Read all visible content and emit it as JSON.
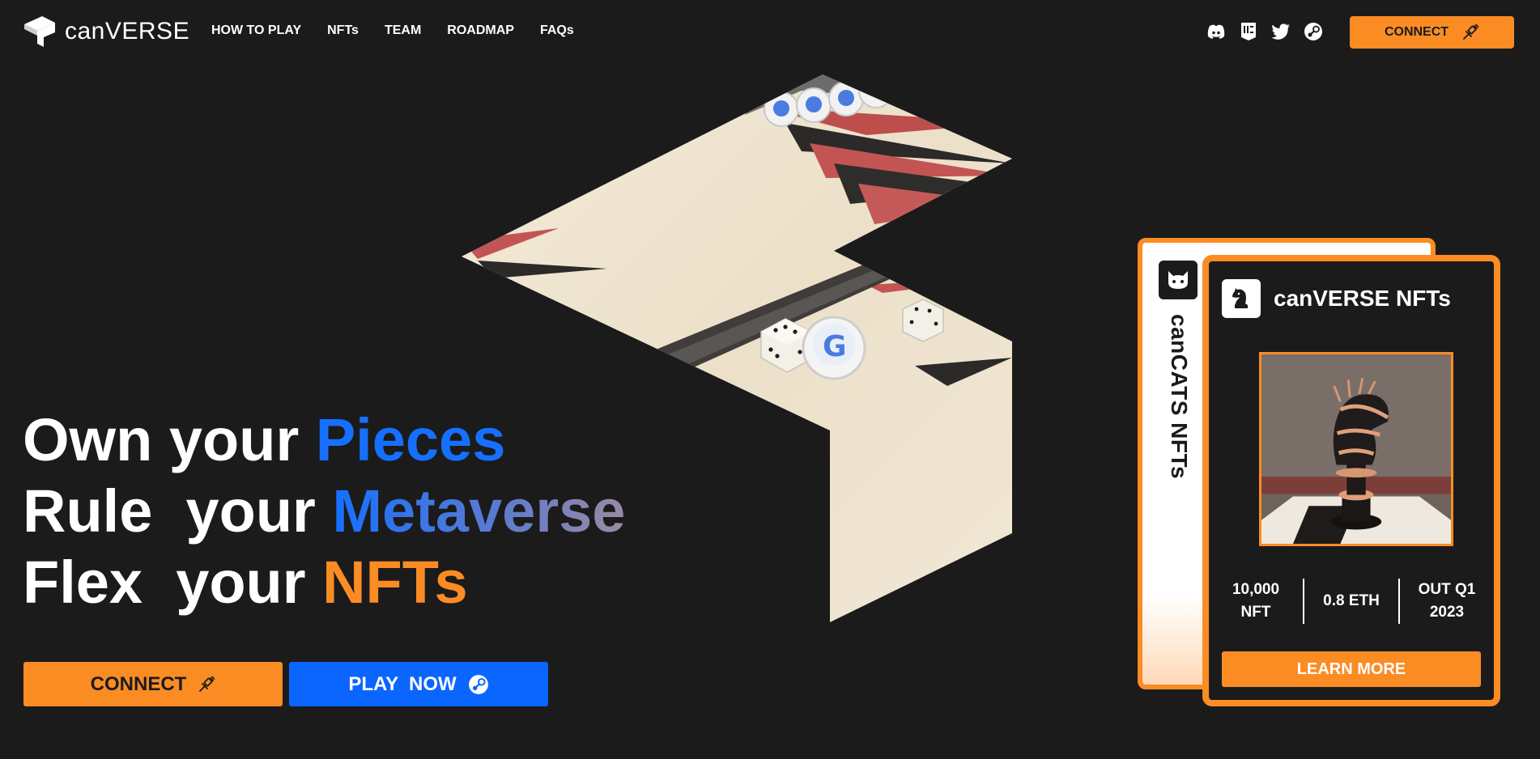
{
  "brand": {
    "name_prefix": "can",
    "name_suffix": "VERSE"
  },
  "nav": {
    "items": [
      "HOW TO PLAY",
      "NFTs",
      "TEAM",
      "ROADMAP",
      "FAQs"
    ]
  },
  "socials": [
    "discord-icon",
    "epic-games-icon",
    "twitter-icon",
    "steam-icon"
  ],
  "header": {
    "connect_label": "CONNECT"
  },
  "hero": {
    "line1": {
      "prefix": "Own your ",
      "highlight": "Pieces"
    },
    "line2": {
      "prefix": "Rule  your ",
      "highlight": "Metaverse"
    },
    "line3": {
      "prefix": "Flex  your ",
      "highlight": "NFTs"
    },
    "connect_label": "CONNECT",
    "play_label": "PLAY  NOW"
  },
  "cards": {
    "back": {
      "label": "canCATS NFTs"
    },
    "front": {
      "title": "canVERSE NFTs",
      "stats": [
        {
          "line1": "10,000",
          "line2": "NFT"
        },
        {
          "line1": "0.8 ETH",
          "line2": ""
        },
        {
          "line1": "OUT Q1",
          "line2": "2023"
        }
      ],
      "learn_more_label": "LEARN MORE"
    }
  },
  "colors": {
    "background": "#1b1b1c",
    "accent_orange": "#fb8c24",
    "accent_blue": "#1670ff",
    "board_cream": "#efe4d1"
  }
}
